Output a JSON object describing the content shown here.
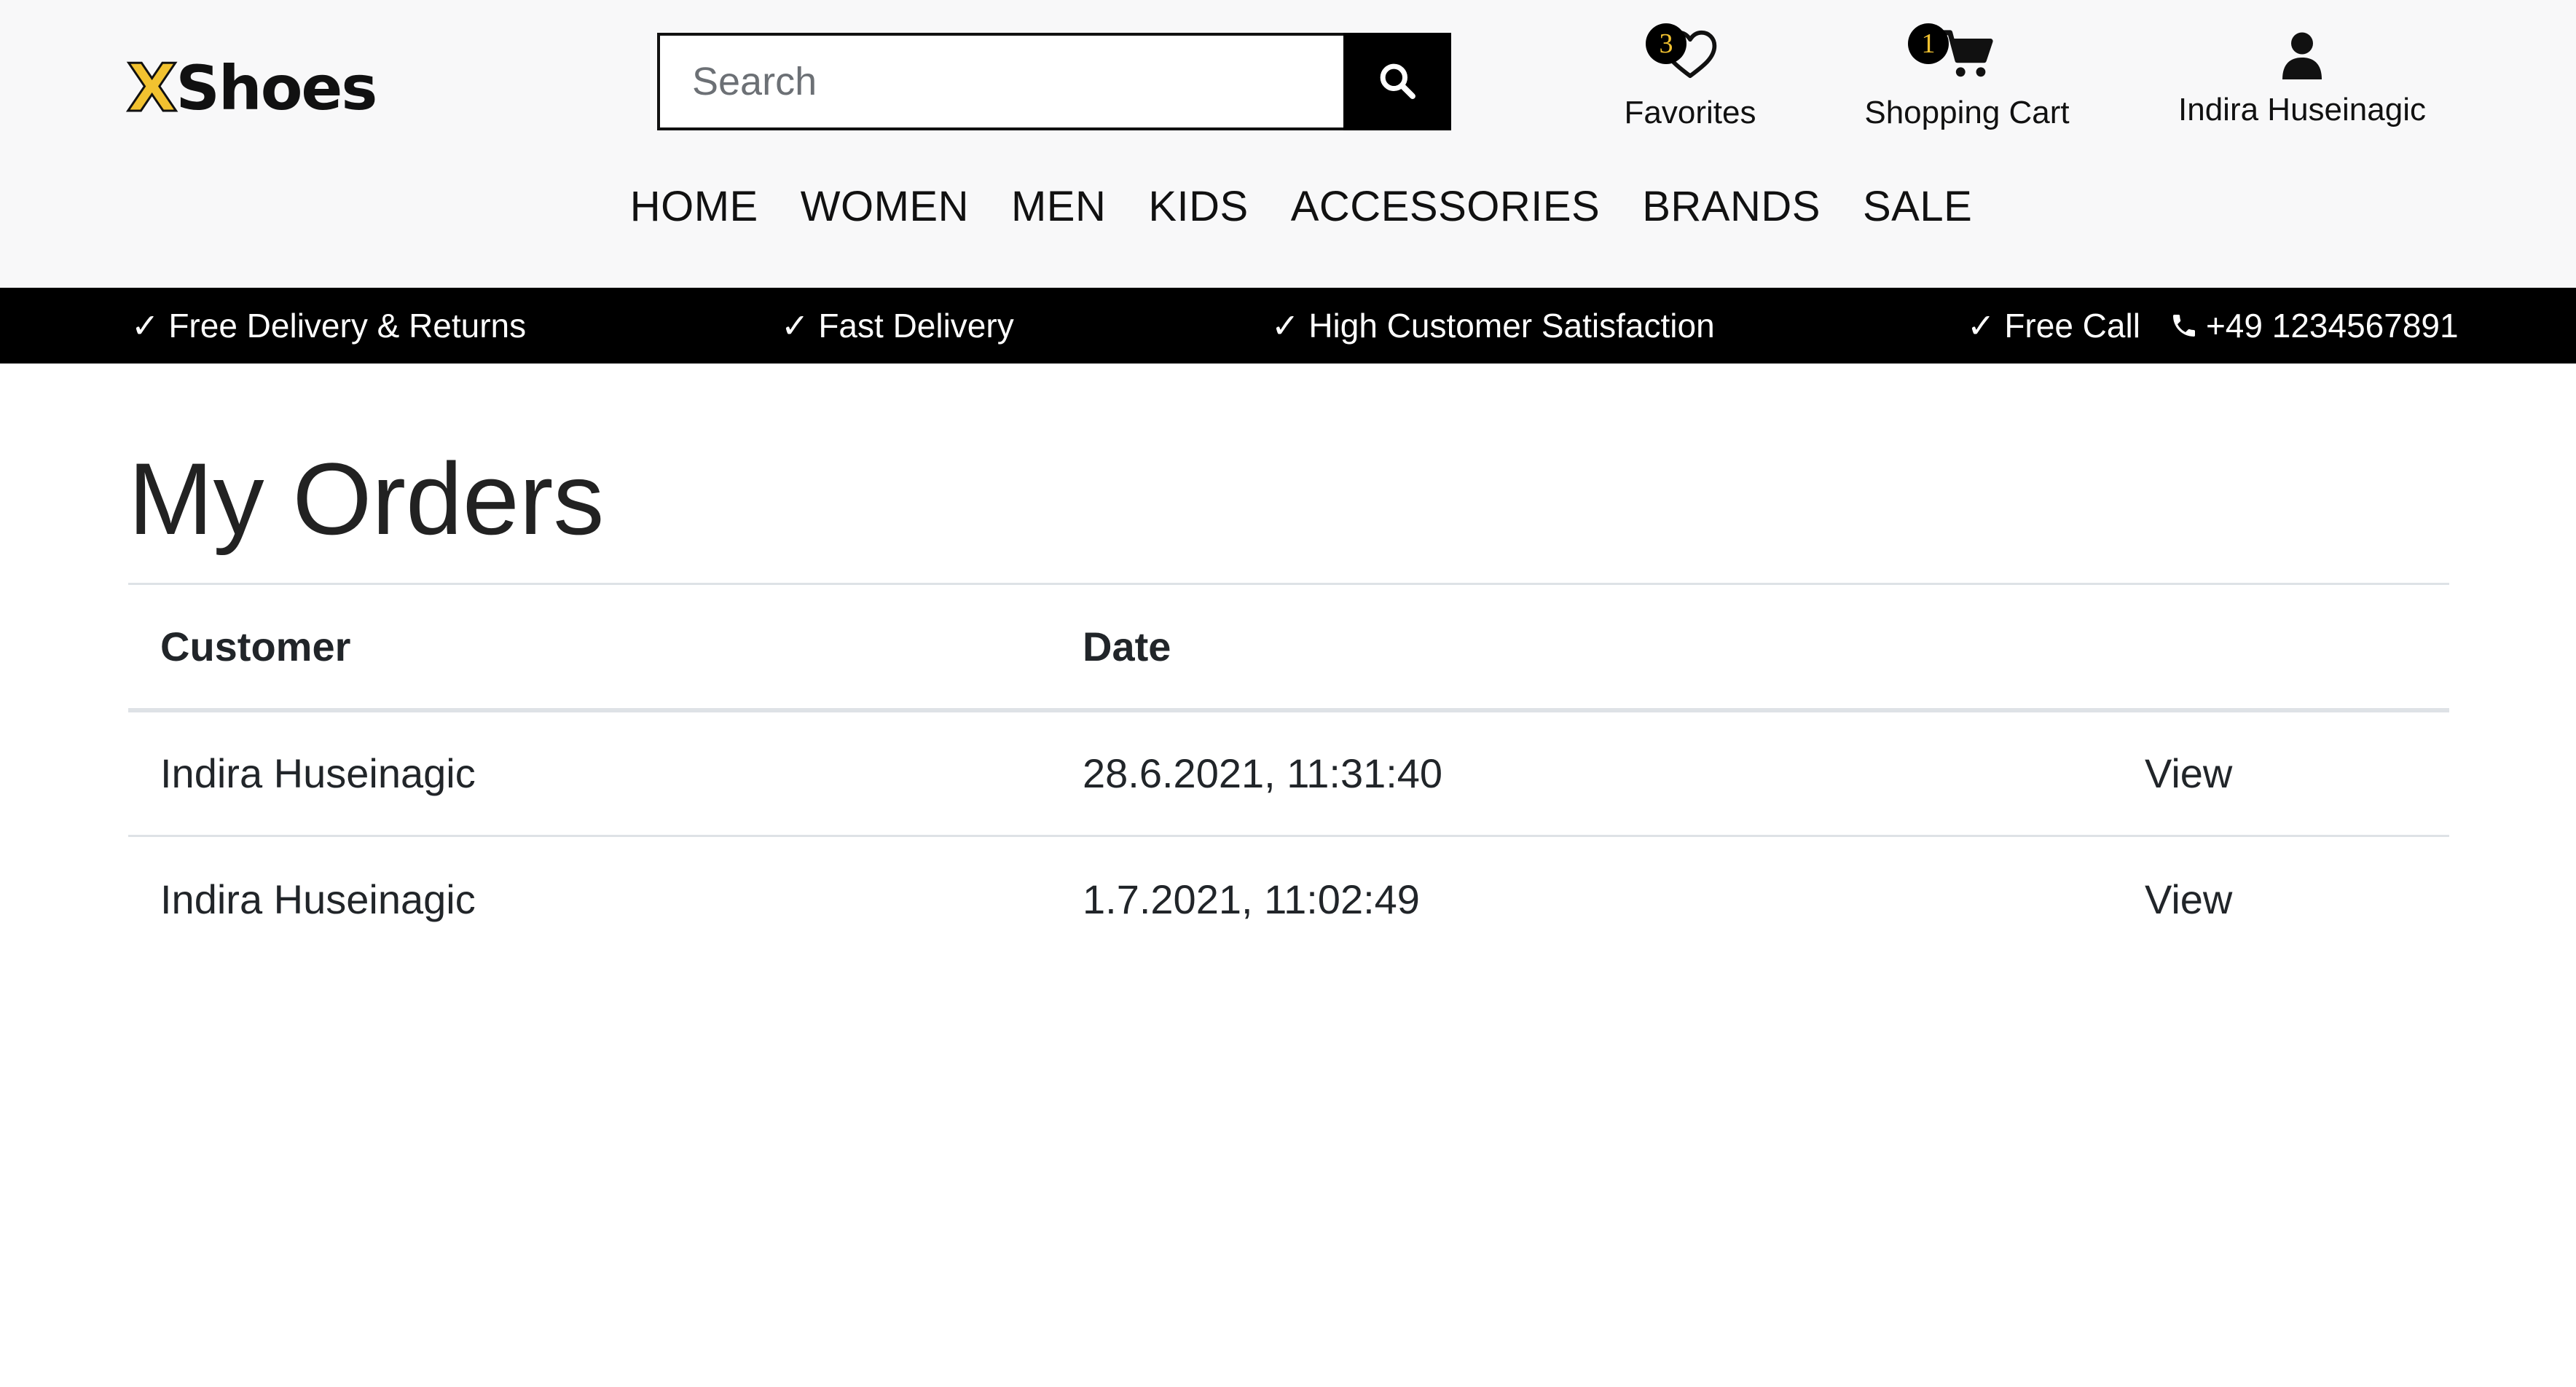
{
  "brand": {
    "logo_letter": "X",
    "logo_text": "Shoes",
    "accent_color": "#f2c230"
  },
  "search": {
    "placeholder": "Search",
    "value": "",
    "button_icon": "search-icon"
  },
  "header_links": {
    "favorites": {
      "label": "Favorites",
      "count": "3",
      "icon": "heart-icon"
    },
    "cart": {
      "label": "Shopping Cart",
      "count": "1",
      "icon": "cart-icon"
    },
    "user": {
      "label": "Indira Huseinagic",
      "icon": "user-icon"
    }
  },
  "nav": {
    "items": [
      "HOME",
      "WOMEN",
      "MEN",
      "KIDS",
      "ACCESSORIES",
      "BRANDS",
      "SALE"
    ]
  },
  "info_bar": {
    "items": [
      "✓ Free Delivery & Returns",
      "✓ Fast Delivery",
      "✓ High Customer Satisfaction",
      "✓ Free Call"
    ],
    "phone": "+49 1234567891",
    "phone_icon": "phone-icon"
  },
  "page": {
    "title": "My Orders"
  },
  "orders_table": {
    "headers": [
      "Customer",
      "Date",
      ""
    ],
    "rows": [
      {
        "customer": "Indira Huseinagic",
        "date": "28.6.2021, 11:31:40",
        "action": "View"
      },
      {
        "customer": "Indira Huseinagic",
        "date": "1.7.2021, 11:02:49",
        "action": "View"
      }
    ]
  }
}
